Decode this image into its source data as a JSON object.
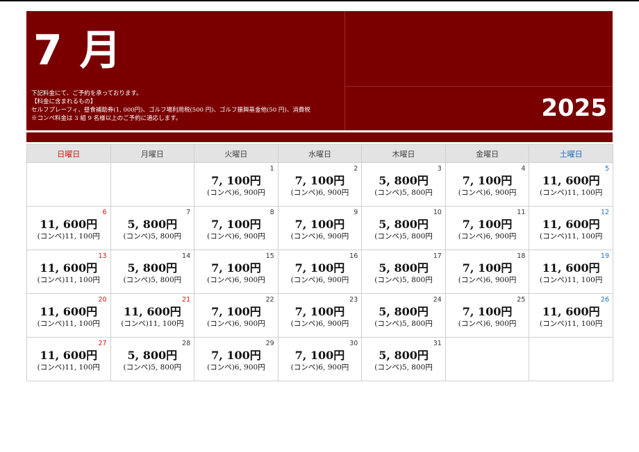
{
  "header": {
    "month": "7 月",
    "year": "2025",
    "notes": [
      "下記料金にて、ご予約を承っております。",
      "【料金に含まれるもの】",
      "セルフプレーフィ、昼食補助券(1, 000円)、ゴルフ場利用税(500 円)、ゴルフ振興基金他(50 円)、消費税",
      "※コンペ料金は 3 組 9 名様以上のご予約に適応します。"
    ]
  },
  "weekdays": [
    "日曜日",
    "月曜日",
    "火曜日",
    "水曜日",
    "木曜日",
    "金曜日",
    "土曜日"
  ],
  "weeks": [
    [
      null,
      null,
      {
        "day": "1",
        "price": "7, 100円",
        "compe": "(コンペ)6, 900円"
      },
      {
        "day": "2",
        "price": "7, 100円",
        "compe": "(コンペ)6, 900円"
      },
      {
        "day": "3",
        "price": "5, 800円",
        "compe": "(コンペ)5, 800円"
      },
      {
        "day": "4",
        "price": "7, 100円",
        "compe": "(コンペ)6, 900円"
      },
      {
        "day": "5",
        "price": "11, 600円",
        "compe": "(コンペ)11, 100円"
      }
    ],
    [
      {
        "day": "6",
        "price": "11, 600円",
        "compe": "(コンペ)11, 100円"
      },
      {
        "day": "7",
        "price": "5, 800円",
        "compe": "(コンペ)5, 800円"
      },
      {
        "day": "8",
        "price": "7, 100円",
        "compe": "(コンペ)6, 900円"
      },
      {
        "day": "9",
        "price": "7, 100円",
        "compe": "(コンペ)6, 900円"
      },
      {
        "day": "10",
        "price": "5, 800円",
        "compe": "(コンペ)5, 800円"
      },
      {
        "day": "11",
        "price": "7, 100円",
        "compe": "(コンペ)6, 900円"
      },
      {
        "day": "12",
        "price": "11, 600円",
        "compe": "(コンペ)11, 100円"
      }
    ],
    [
      {
        "day": "13",
        "price": "11, 600円",
        "compe": "(コンペ)11, 100円"
      },
      {
        "day": "14",
        "price": "5, 800円",
        "compe": "(コンペ)5, 800円"
      },
      {
        "day": "15",
        "price": "7, 100円",
        "compe": "(コンペ)6, 900円"
      },
      {
        "day": "16",
        "price": "7, 100円",
        "compe": "(コンペ)6, 900円"
      },
      {
        "day": "17",
        "price": "5, 800円",
        "compe": "(コンペ)5, 800円"
      },
      {
        "day": "18",
        "price": "7, 100円",
        "compe": "(コンペ)6, 900円"
      },
      {
        "day": "19",
        "price": "11, 600円",
        "compe": "(コンペ)11, 100円"
      }
    ],
    [
      {
        "day": "20",
        "price": "11, 600円",
        "compe": "(コンペ)11, 100円"
      },
      {
        "day": "21",
        "price": "11, 600円",
        "compe": "(コンペ)11, 100円",
        "holiday": true
      },
      {
        "day": "22",
        "price": "7, 100円",
        "compe": "(コンペ)6, 900円"
      },
      {
        "day": "23",
        "price": "7, 100円",
        "compe": "(コンペ)6, 900円"
      },
      {
        "day": "24",
        "price": "5, 800円",
        "compe": "(コンペ)5, 800円"
      },
      {
        "day": "25",
        "price": "7, 100円",
        "compe": "(コンペ)6, 900円"
      },
      {
        "day": "26",
        "price": "11, 600円",
        "compe": "(コンペ)11, 100円"
      }
    ],
    [
      {
        "day": "27",
        "price": "11, 600円",
        "compe": "(コンペ)11, 100円"
      },
      {
        "day": "28",
        "price": "5, 800円",
        "compe": "(コンペ)5, 800円"
      },
      {
        "day": "29",
        "price": "7, 100円",
        "compe": "(コンペ)6, 900円"
      },
      {
        "day": "30",
        "price": "7, 100円",
        "compe": "(コンペ)6, 900円"
      },
      {
        "day": "31",
        "price": "5, 800円",
        "compe": "(コンペ)5, 800円"
      },
      null,
      null
    ]
  ],
  "colors": {
    "header_bg": "#7a0000",
    "sunday_holiday": "#e01010",
    "saturday": "#1a6fc4"
  }
}
